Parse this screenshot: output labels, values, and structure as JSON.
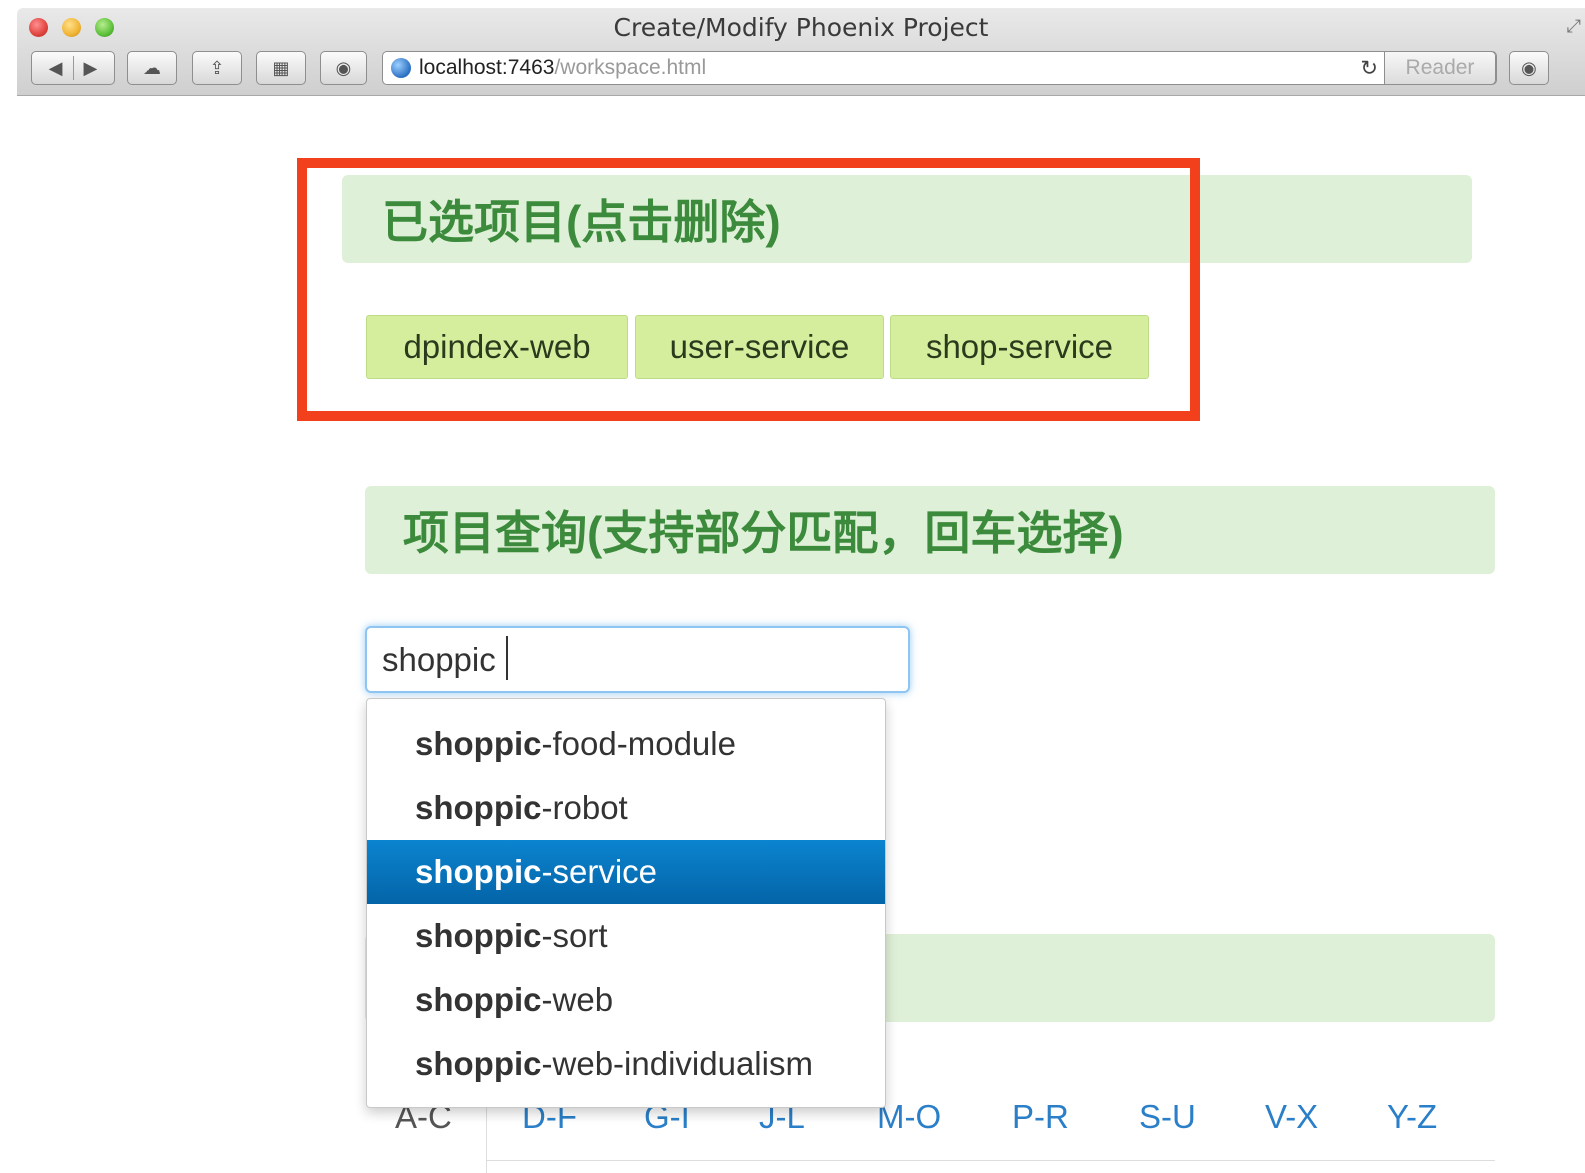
{
  "window": {
    "title": "Create/Modify Phoenix Project",
    "url_host": "localhost:7463",
    "url_path": "/workspace.html",
    "reader_label": "Reader"
  },
  "toolbar": {
    "back_symbol": "◀",
    "forward_symbol": "▶",
    "icloud_symbol": "☁",
    "share_symbol": "⇪",
    "topsites_symbol": "▦",
    "extension_symbol": "◉",
    "reload_symbol": "↻",
    "fullscreen_symbol": "⤢"
  },
  "selected": {
    "title": "已选项目(点击删除)",
    "tags": [
      "dpindex-web",
      "user-service",
      "shop-service"
    ]
  },
  "query": {
    "title": "项目查询(支持部分匹配，回车选择)",
    "input_value": "shoppic",
    "suggestions": [
      {
        "match": "shoppic",
        "rest": "-food-module"
      },
      {
        "match": "shoppic",
        "rest": "-robot"
      },
      {
        "match": "shoppic",
        "rest": "-service"
      },
      {
        "match": "shoppic",
        "rest": "-sort"
      },
      {
        "match": "shoppic",
        "rest": "-web"
      },
      {
        "match": "shoppic",
        "rest": "-web-individualism"
      }
    ],
    "active_suggestion": 2
  },
  "alphabet_tabs": [
    "A-C",
    "D-F",
    "G-I",
    "J-L",
    "M-O",
    "P-R",
    "S-U",
    "V-X",
    "Y-Z"
  ],
  "colors": {
    "header_bg": "#dff0d8",
    "header_text": "#3c8a3c",
    "tag_bg": "#d5ee9e",
    "highlight_border": "#f2401c",
    "active_item": "#0b84cf",
    "link": "#2a7fc8"
  }
}
